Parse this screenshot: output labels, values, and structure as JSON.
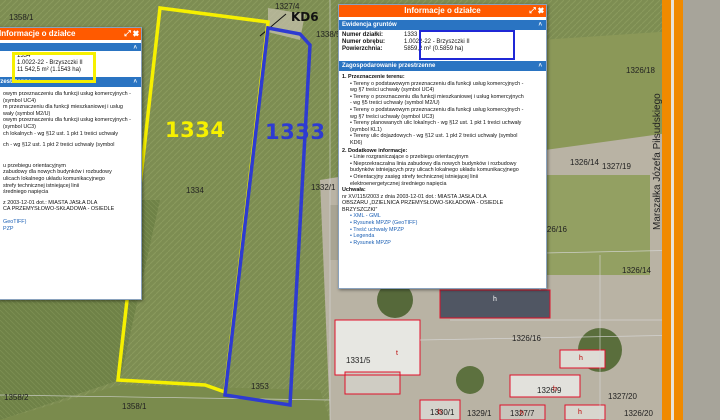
{
  "map": {
    "street_name": "Marszałka Józefa Piłsudskiego",
    "road_label": "KD6",
    "plot_left_big": "1334",
    "plot_right_big": "1333",
    "colors": {
      "plot_1334": "#f6f000",
      "plot_1333": "#2e3bd1",
      "panel_header": "#ff5a00",
      "section_header": "#2a74c2",
      "road": "#f08a00"
    },
    "parcel_labels": [
      "1358/1",
      "1327/4",
      "1338/5",
      "1334",
      "1332/1",
      "1353",
      "1358/2",
      "1358/1",
      "1326/18",
      "1326/14",
      "1327/19",
      "1326/16",
      "1326/14",
      "1326/16",
      "1331/5",
      "1326/9",
      "1327/20",
      "1330/1",
      "1329/1",
      "1327/7",
      "1326/20"
    ],
    "building_marks": [
      "h",
      "t",
      "h",
      "h",
      "h",
      "h",
      "h"
    ]
  },
  "left_panel": {
    "title": "Informacje o działce",
    "values": [
      "1334",
      "1.0022-22 - Brzyszczki II",
      "11 542,5 m² (1.1543 ha)"
    ],
    "section_cut": "rzestrzenne",
    "lines": [
      "owym przeznaczeniu dla funkcji usług komercyjnych -",
      "(symbol UC4)",
      "m przeznaczeniu dla funkcji mieszkaniowej i usług",
      "wały (symbol M2/U)",
      "owym przeznaczeniu dla funkcji usług komercyjnych -",
      "(symbol UC3)",
      "ch lokalnych - wg §12 ust. 1 pkt 1 treści uchwały",
      "",
      "ch - wg §12 ust. 1 pkt 2 treści uchwały (symbol"
    ],
    "lines2": [
      "u przebiegu orientacyjnym",
      "zabudowy dla nowych budynków i rozbudowy",
      "ulicach lokalnego układu komunikacyjnego",
      "strefy technicznej istniejącej linii",
      "średniego napięcia"
    ],
    "resolution": "z 2003-12-01 dot.: MIASTA JASŁA DLA",
    "resolution2": "CA PRZEMYSŁOWO-SKŁADOWA - OSIEDLE",
    "links": [
      "GeoTIFF)",
      "PZP"
    ]
  },
  "right_panel": {
    "title": "Informacje o działce",
    "sec1": "Ewidencja gruntów",
    "rows": [
      {
        "k": "Numer działki:",
        "v": "1333"
      },
      {
        "k": "Numer obrębu:",
        "v": "1.0022-22 - Brzyszczki II"
      },
      {
        "k": "Powierzchnia:",
        "v": "5859,2 m² (0.5859 ha)"
      }
    ],
    "sec2": "Zagospodarowanie przestrzenne",
    "p1_head": "1.  Przeznaczenie terenu:",
    "p1_items": [
      "•  Tereny o podstawowym przeznaczeniu dla funkcji usług komercyjnych -",
      "   wg §7 treści uchwały (symbol UC4)",
      "•  Tereny o przeznaczeniu dla funkcji mieszkaniowej i usług komercyjnych",
      "   - wg §5 treści uchwały (symbol M2/U)",
      "•  Tereny o podstawowym przeznaczeniu dla funkcji usług komercyjnych -",
      "   wg §7 treści uchwały (symbol UC3)",
      "•  Tereny planowanych ulic lokalnych - wg §12 ust. 1 pkt 1 treści uchwały",
      "   (symbol KL1)",
      "•  Tereny ulic dojazdowych - wg §12 ust. 1 pkt 2 treści uchwały (symbol",
      "   KD6)"
    ],
    "p2_head": "2.  Dodatkowe informacje:",
    "p2_items": [
      "•  Linie rozgraniczające o przebiegu orientacyjnym",
      "•  Nieprzekraczalna linia zabudowy dla nowych budynków i rozbudowy",
      "   budynków istniejących przy ulicach lokalnego układu komunikacyjnego",
      "•  Orientacyjny zasięg strefy technicznej istniejącej linii",
      "   elektroenergetycznej średniego napięcia"
    ],
    "uchwala_head": "Uchwała:",
    "uchwala_lines": [
      "nr XV/115/2003 z dnia 2003-12-01 dot.: MIASTA JASŁA DLA",
      "OBSZARU „DZIELNICA PRZEMYSŁOWO-SKŁADOWA - OSIEDLE",
      "BRZYSZCZKI”"
    ],
    "links": [
      "XML - GML",
      "Rysunek MPZP (GeoTIFF)",
      "Treść uchwały MPZP",
      "Legenda",
      "Rysunek MPZP"
    ]
  }
}
